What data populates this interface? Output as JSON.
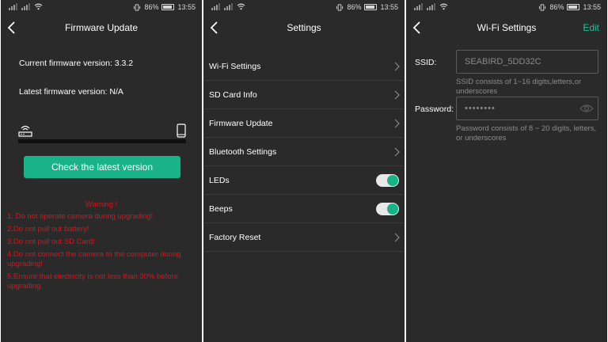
{
  "status": {
    "battery": "86%",
    "time": "13:55"
  },
  "panel1": {
    "title": "Firmware Update",
    "current_version": "Current firmware version: 3.3.2",
    "latest_version": "Latest firmware version: N/A",
    "button": "Check the latest version",
    "warning_title": "Warning !",
    "warnings": [
      "1. Do not operate camera during upgrading!",
      "2.Do not pull out battery!",
      "3.Do not pull out SD Card!",
      "4.Do not connect the camera to the computer during upgrading!",
      "5.Ensure that electricity is not less than 30% before upgrading."
    ]
  },
  "panel2": {
    "title": "Settings",
    "items": [
      {
        "label": "Wi-Fi Settings",
        "type": "chevron"
      },
      {
        "label": "SD Card Info",
        "type": "chevron"
      },
      {
        "label": "Firmware Update",
        "type": "chevron"
      },
      {
        "label": "Bluetooth Settings",
        "type": "chevron"
      },
      {
        "label": "LEDs",
        "type": "toggle",
        "on": true
      },
      {
        "label": "Beeps",
        "type": "toggle",
        "on": true
      },
      {
        "label": "Factory Reset",
        "type": "chevron"
      }
    ]
  },
  "panel3": {
    "title": "Wi-Fi Settings",
    "edit": "Edit",
    "ssid_label": "SSID:",
    "ssid_value": "SEABIRD_5DD32C",
    "ssid_hint": "SSID consists of 1~16 digits,letters,or underscores",
    "password_label": "Password:",
    "password_value": "••••••••",
    "password_hint": "Password consists of 8 ~ 20 digits, letters, or underscores"
  },
  "colors": {
    "accent": "#19b38a",
    "warning": "#d8161b",
    "panel_bg": "#2a2a2a"
  },
  "icons": [
    "back-arrow-icon",
    "chevron-right-icon",
    "router-icon",
    "phone-icon",
    "eye-icon",
    "wifi-icon",
    "signal-icon",
    "battery-icon",
    "vibrate-icon"
  ]
}
